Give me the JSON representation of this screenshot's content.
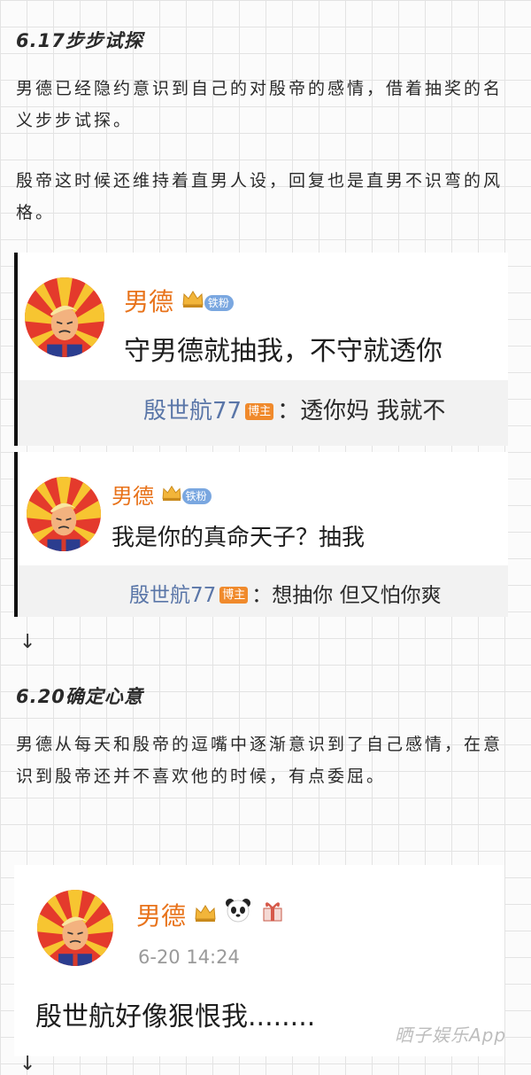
{
  "section1": {
    "heading": "6.17步步试探",
    "para1": "男德已经隐约意识到自己的对殷帝的感情，借着抽奖的名义步步试探。",
    "para2": "殷帝这时候还维持着直男人设，回复也是直男不识弯的风格。"
  },
  "card1": {
    "username": "男德",
    "fan_badge": "铁粉",
    "message": "守男德就抽我，不守就透你",
    "reply_name": "殷世航77",
    "reply_badge": "博主",
    "reply_text": "：透你妈 我就不"
  },
  "card2": {
    "username": "男德",
    "fan_badge": "铁粉",
    "message": "我是你的真命天子？抽我",
    "reply_name": "殷世航77",
    "reply_badge": "博主",
    "reply_text": "：想抽你 但又怕你爽"
  },
  "arrow": "↓",
  "section2": {
    "heading": "6.20确定心意",
    "para1": "男德从每天和殷帝的逗嘴中逐渐意识到了自己感情，在意识到殷帝还并不喜欢他的时候，有点委屈。"
  },
  "card3": {
    "username": "男德",
    "timestamp": "6-20 14:24",
    "message": "殷世航好像狠恨我........"
  },
  "watermark": "晒子娱乐App",
  "colors": {
    "username": "#e8731b",
    "reply_name": "#5a76a8",
    "badge_blogger": "#f08a2c",
    "badge_fan": "#7aa7e0"
  }
}
